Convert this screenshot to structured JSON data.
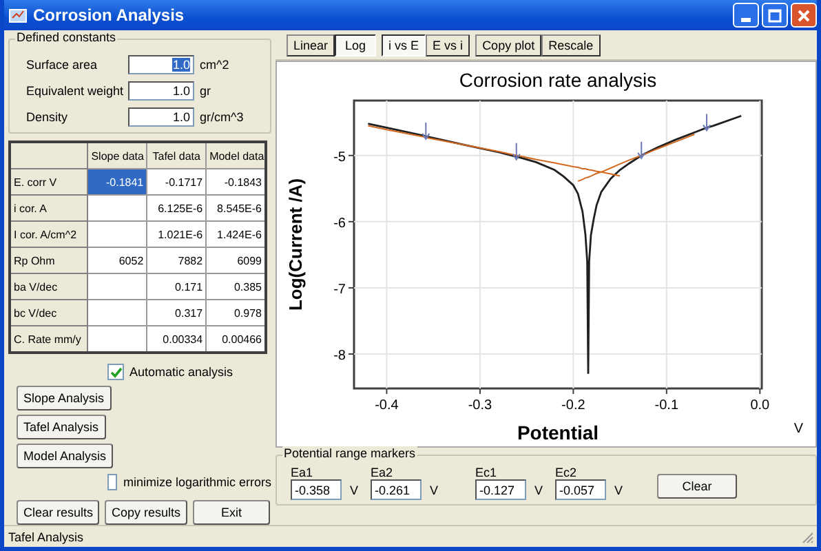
{
  "window": {
    "title": "Corrosion Analysis"
  },
  "constants": {
    "title": "Defined constants",
    "fields": [
      {
        "label": "Surface area",
        "value": "1.0",
        "unit": "cm^2",
        "text_selected": true
      },
      {
        "label": "Equivalent weight",
        "value": "1.0",
        "unit": "gr",
        "text_selected": false
      },
      {
        "label": "Density",
        "value": "1.0",
        "unit": "gr/cm^3",
        "text_selected": false
      }
    ]
  },
  "table": {
    "columns": [
      "Slope data",
      "Tafel data",
      "Model data"
    ],
    "rows": [
      {
        "label": "E. corr V",
        "cells": [
          {
            "text": "-0.1841",
            "selected": true
          },
          {
            "text": "-0.1717",
            "selected": false
          },
          {
            "text": "-0.1843",
            "selected": false
          }
        ]
      },
      {
        "label": "i cor. A",
        "cells": [
          {
            "selected": false
          },
          {
            "text": "6.125E-6",
            "selected": false
          },
          {
            "text": "8.545E-6",
            "selected": false
          }
        ]
      },
      {
        "label": "I cor. A/cm^2",
        "cells": [
          {
            "selected": false
          },
          {
            "text": "1.021E-6",
            "selected": false
          },
          {
            "text": "1.424E-6",
            "selected": false
          }
        ]
      },
      {
        "label": "Rp  Ohm",
        "cells": [
          {
            "text": "6052",
            "selected": false
          },
          {
            "text": "7882",
            "selected": false
          },
          {
            "text": "6099",
            "selected": false
          }
        ]
      },
      {
        "label": "ba  V/dec",
        "cells": [
          {
            "selected": false
          },
          {
            "text": "0.171",
            "selected": false
          },
          {
            "text": "0.385",
            "selected": false
          }
        ]
      },
      {
        "label": "bc  V/dec",
        "cells": [
          {
            "selected": false
          },
          {
            "text": "0.317",
            "selected": false
          },
          {
            "text": "0.978",
            "selected": false
          }
        ]
      },
      {
        "label": "C. Rate mm/y",
        "cells": [
          {
            "selected": false
          },
          {
            "text": "0.00334",
            "selected": false
          },
          {
            "text": "0.00466",
            "selected": false
          }
        ]
      }
    ]
  },
  "automatic_analysis": {
    "label": "Automatic analysis",
    "checked": true
  },
  "analysis_buttons": [
    "Slope Analysis",
    "Tafel Analysis",
    "Model Analysis"
  ],
  "minimize_errors": {
    "label": "minimize logarithmic errors",
    "checked": false
  },
  "bottom_buttons": [
    "Clear results",
    "Copy results",
    "Exit"
  ],
  "toolbar": [
    {
      "label": "Linear",
      "selected": false
    },
    {
      "label": "Log",
      "selected": true
    },
    {
      "label": "i vs E",
      "selected": true
    },
    {
      "label": "E vs i",
      "selected": false
    },
    {
      "label": "Copy plot",
      "selected": false
    },
    {
      "label": "Rescale",
      "selected": false
    }
  ],
  "plot": {
    "unit": "V",
    "chart_data": {
      "type": "line",
      "title": "Corrosion rate analysis",
      "xlabel": "Potential",
      "ylabel": "Log(Current /A)",
      "x": [
        -0.42,
        -0.4,
        -0.36,
        -0.358,
        -0.32,
        -0.28,
        -0.261,
        -0.26,
        -0.24,
        -0.22,
        -0.21,
        -0.2,
        -0.195,
        -0.19,
        -0.187,
        -0.185,
        -0.184,
        -0.183,
        -0.181,
        -0.178,
        -0.175,
        -0.17,
        -0.16,
        -0.15,
        -0.14,
        -0.127,
        -0.11,
        -0.09,
        -0.07,
        -0.057,
        -0.05,
        -0.02
      ],
      "series": [
        {
          "color": "#202020",
          "values": [
            -4.52,
            -4.58,
            -4.7,
            -4.71,
            -4.83,
            -4.95,
            -5.02,
            -5.02,
            -5.1,
            -5.22,
            -5.32,
            -5.45,
            -5.58,
            -5.85,
            -6.2,
            -6.6,
            -8.3,
            -6.6,
            -6.2,
            -5.95,
            -5.75,
            -5.55,
            -5.35,
            -5.22,
            -5.12,
            -5.0,
            -4.88,
            -4.76,
            -4.65,
            -4.58,
            -4.55,
            -4.4
          ]
        },
        {
          "color": "#d2691e",
          "values": [
            -4.55,
            -4.61,
            -4.72,
            -4.73,
            -4.83,
            -4.94,
            -5.0,
            -5.0,
            -5.06,
            -5.11,
            -5.14,
            -5.17,
            -5.18,
            -5.2,
            -5.2,
            -5.21,
            -5.21,
            -5.22,
            -5.22,
            -5.23,
            -5.24,
            -5.25,
            -5.28,
            -5.31,
            null,
            null,
            null,
            null,
            null,
            null,
            null,
            null
          ]
        },
        {
          "color": "#d2691e",
          "values": [
            null,
            null,
            null,
            null,
            null,
            null,
            null,
            null,
            null,
            null,
            null,
            null,
            -5.39,
            -5.36,
            -5.34,
            -5.33,
            -5.33,
            -5.32,
            -5.31,
            -5.29,
            -5.27,
            -5.25,
            -5.19,
            -5.13,
            -5.07,
            -5.0,
            -4.9,
            -4.79,
            -4.68,
            null,
            null,
            null
          ]
        },
        {
          "color": "#6a7ab8",
          "marker": "cross",
          "values": [
            null,
            null,
            null,
            -4.71,
            null,
            null,
            -5.02,
            null,
            null,
            null,
            null,
            null,
            null,
            null,
            null,
            null,
            null,
            null,
            null,
            null,
            null,
            null,
            null,
            null,
            null,
            -5.0,
            null,
            null,
            null,
            -4.58,
            null,
            null
          ]
        }
      ],
      "grid": true,
      "xlim": [
        -0.435,
        0.002
      ],
      "ylim": [
        -8.52,
        -4.17
      ],
      "xticks": [
        {
          "value": -0.4,
          "label": "-0.4"
        },
        {
          "value": -0.3,
          "label": "-0.3"
        },
        {
          "value": -0.2,
          "label": "-0.2"
        },
        {
          "value": -0.1,
          "label": "-0.1"
        },
        {
          "value": 0,
          "label": "0.0"
        }
      ],
      "yticks": [
        {
          "value": -5,
          "label": "-5"
        },
        {
          "value": -6,
          "label": "-6"
        },
        {
          "value": -7,
          "label": "-7"
        },
        {
          "value": -8,
          "label": "-8"
        }
      ]
    }
  },
  "markers": {
    "title": "Potential range markers",
    "fields": [
      {
        "label": "Ea1",
        "value": "-0.358",
        "unit": "V"
      },
      {
        "label": "Ea2",
        "value": "-0.261",
        "unit": "V"
      },
      {
        "label": "Ec1",
        "value": "-0.127",
        "unit": "V"
      },
      {
        "label": "Ec2",
        "value": "-0.057",
        "unit": "V"
      }
    ],
    "button": "Clear"
  },
  "status_bar": "Tafel Analysis"
}
